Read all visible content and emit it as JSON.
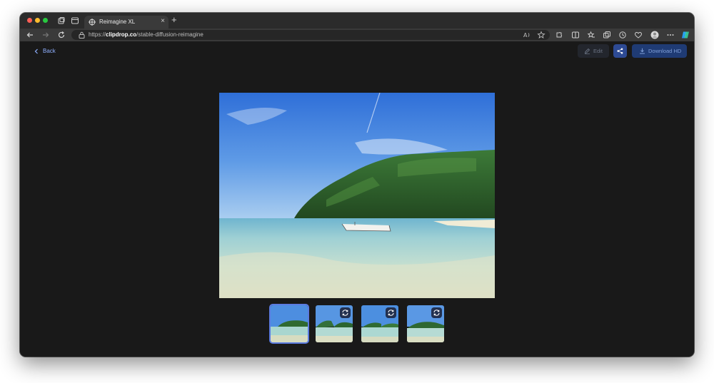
{
  "browser": {
    "tab_title": "Reimagine XL",
    "new_tab_symbol": "+",
    "close_symbol": "×",
    "url_scheme": "https://",
    "url_domain": "clipdrop.co",
    "url_path": "/stable-diffusion-reimagine"
  },
  "nav": {
    "back_label": "Back"
  },
  "actions": {
    "edit_label": "Edit",
    "download_label": "Download HD"
  },
  "gallery": {
    "selected_index": 0,
    "thumbnails": [
      {
        "state": "selected"
      },
      {
        "state": "variation",
        "icon": "regenerate-icon"
      },
      {
        "state": "variation",
        "icon": "regenerate-icon"
      },
      {
        "state": "variation",
        "icon": "regenerate-icon"
      }
    ]
  },
  "colors": {
    "accent": "#5b7be0",
    "download_button": "#1f3b74",
    "share_button": "#2d4a94",
    "page_background": "#191919"
  }
}
